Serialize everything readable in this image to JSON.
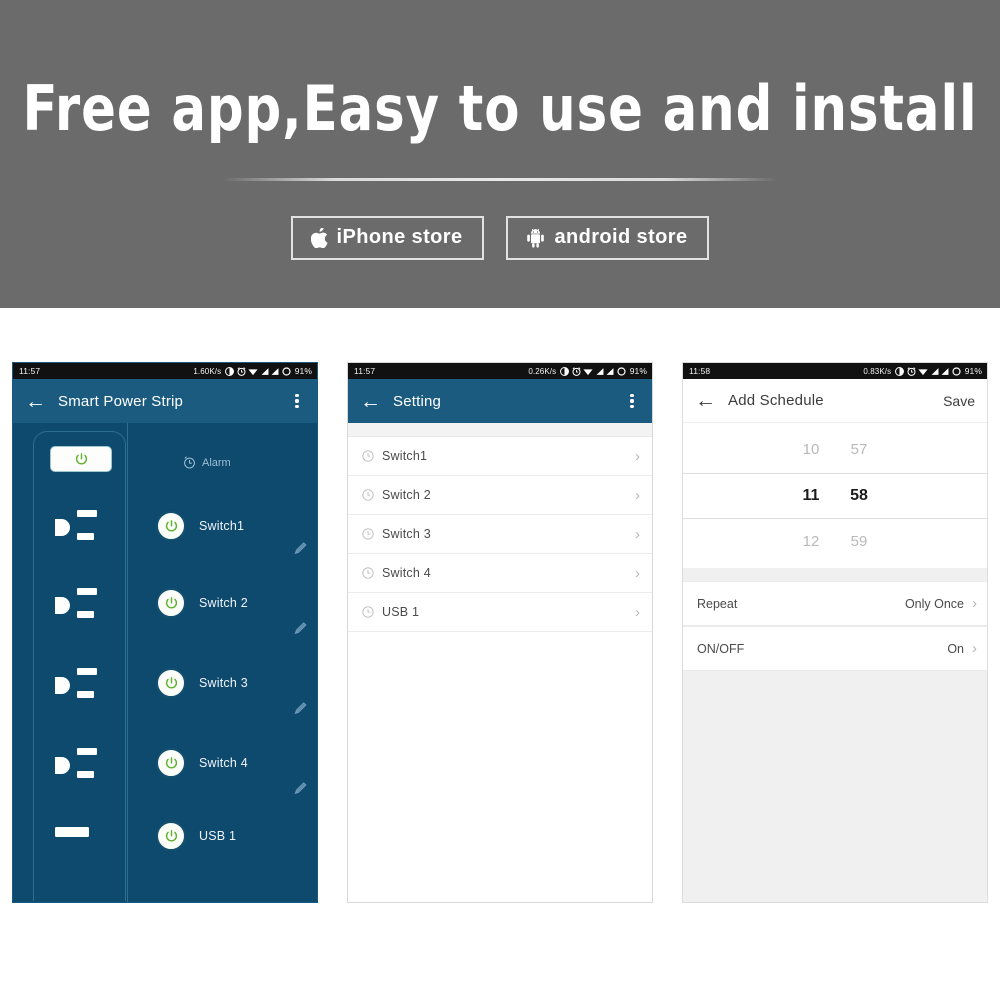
{
  "hero": {
    "title": "Free app,Easy to use and install",
    "stores": [
      {
        "label": "iPhone store",
        "icon": "apple-icon"
      },
      {
        "label": "android store",
        "icon": "android-icon"
      }
    ]
  },
  "panel1": {
    "statusbar": {
      "time": "11:57",
      "speed": "1.60K/s",
      "battery": "91%",
      "icons": [
        "vibrate-icon",
        "alarm-icon",
        "wifi-icon",
        "signal-icon",
        "signal-icon",
        "circle-icon"
      ]
    },
    "appbar": {
      "back": "←",
      "title": "Smart Power Strip",
      "menu": "overflow-menu-icon"
    },
    "alarm_label": "Alarm",
    "master_toggle": "power-icon",
    "switches": [
      {
        "label": "Switch1",
        "socket": "outlet"
      },
      {
        "label": "Switch 2",
        "socket": "outlet"
      },
      {
        "label": "Switch 3",
        "socket": "outlet"
      },
      {
        "label": "Switch 4",
        "socket": "outlet"
      },
      {
        "label": "USB 1",
        "socket": "usb"
      }
    ],
    "colors": {
      "header": "#1b5b80",
      "body": "#0e4a6e",
      "power_green": "#5eb030"
    }
  },
  "panel2": {
    "statusbar": {
      "time": "11:57",
      "speed": "0.26K/s",
      "battery": "91%"
    },
    "appbar": {
      "back": "←",
      "title": "Setting",
      "menu": "overflow-menu-icon"
    },
    "rows": [
      {
        "label": "Switch1",
        "icon": "clock-icon",
        "chevron": "›"
      },
      {
        "label": "Switch 2",
        "icon": "clock-icon",
        "chevron": "›"
      },
      {
        "label": "Switch 3",
        "icon": "clock-icon",
        "chevron": "›"
      },
      {
        "label": "Switch 4",
        "icon": "clock-icon",
        "chevron": "›"
      },
      {
        "label": "USB 1",
        "icon": "clock-icon",
        "chevron": "›"
      }
    ]
  },
  "panel3": {
    "statusbar": {
      "time": "11:58",
      "speed": "0.83K/s",
      "battery": "91%"
    },
    "appbar": {
      "back": "←",
      "title": "Add Schedule",
      "save": "Save"
    },
    "picker": {
      "above": {
        "hour": "10",
        "minute": "57"
      },
      "selected": {
        "hour": "11",
        "minute": "58"
      },
      "below": {
        "hour": "12",
        "minute": "59"
      }
    },
    "rows": [
      {
        "key": "Repeat",
        "value": "Only Once",
        "chevron": "›"
      },
      {
        "key": "ON/OFF",
        "value": "On",
        "chevron": "›"
      }
    ]
  }
}
